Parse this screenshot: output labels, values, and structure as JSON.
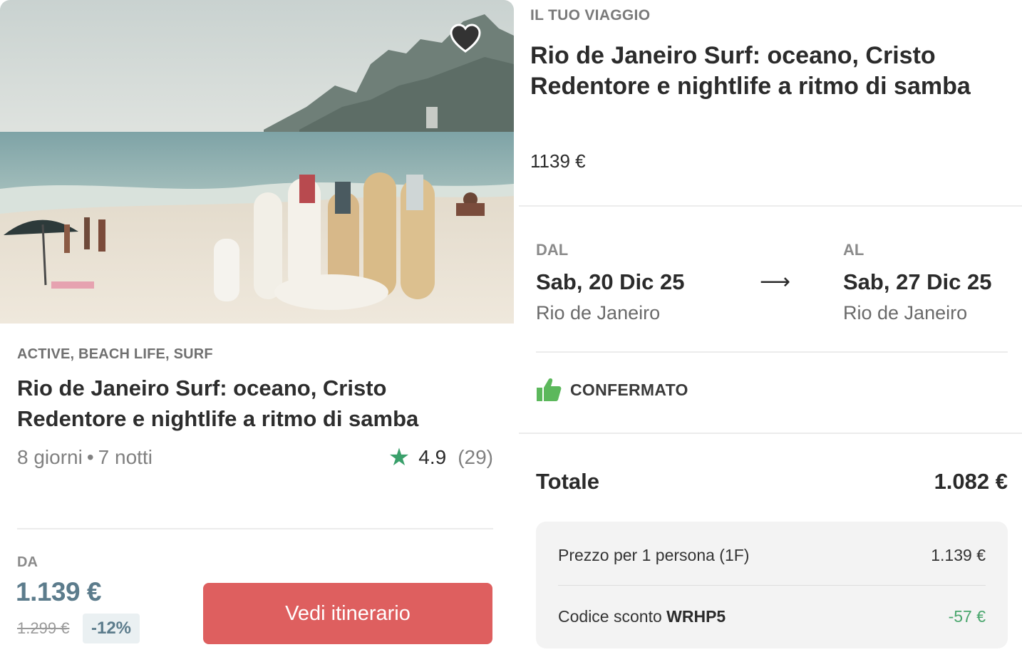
{
  "card": {
    "favorite_icon": "heart-icon",
    "tags": "ACTIVE, BEACH LIFE, SURF",
    "title": "Rio de Janeiro Surf: oceano, Cristo Redentore e nightlife a ritmo di samba",
    "days": "8 giorni",
    "separator": "•",
    "nights": "7 notti",
    "rating_icon": "star-icon",
    "rating_score": "4.9",
    "rating_count": "(29)",
    "from_label": "DA",
    "price": "1.139 €",
    "old_price": "1.299 €",
    "discount": "-12%",
    "cta_label": "Vedi itinerario"
  },
  "trip": {
    "section_label": "IL TUO VIAGGIO",
    "title": "Rio de Janeiro Surf: oceano, Cristo Redentore e nightlife a ritmo di samba",
    "price": "1139 €",
    "from": {
      "label": "DAL",
      "date": "Sab, 20 Dic 25",
      "city": "Rio de Janeiro"
    },
    "arrow": "⟶",
    "to": {
      "label": "AL",
      "date": "Sab, 27 Dic 25",
      "city": "Rio de Janeiro"
    },
    "status_icon": "thumbs-up-icon",
    "status": "CONFERMATO",
    "total_label": "Totale",
    "total_value": "1.082 €",
    "breakdown": {
      "price_label": "Prezzo per 1 persona (1F)",
      "price_value": "1.139 €",
      "code_label": "Codice sconto",
      "code": "WRHP5",
      "code_value": "-57 €"
    }
  },
  "colors": {
    "cta": "#de5f5f",
    "price_accent": "#5c7c8c",
    "star": "#3aa06b",
    "confirmed": "#5cb85c",
    "discount_value": "#4aa66d"
  }
}
